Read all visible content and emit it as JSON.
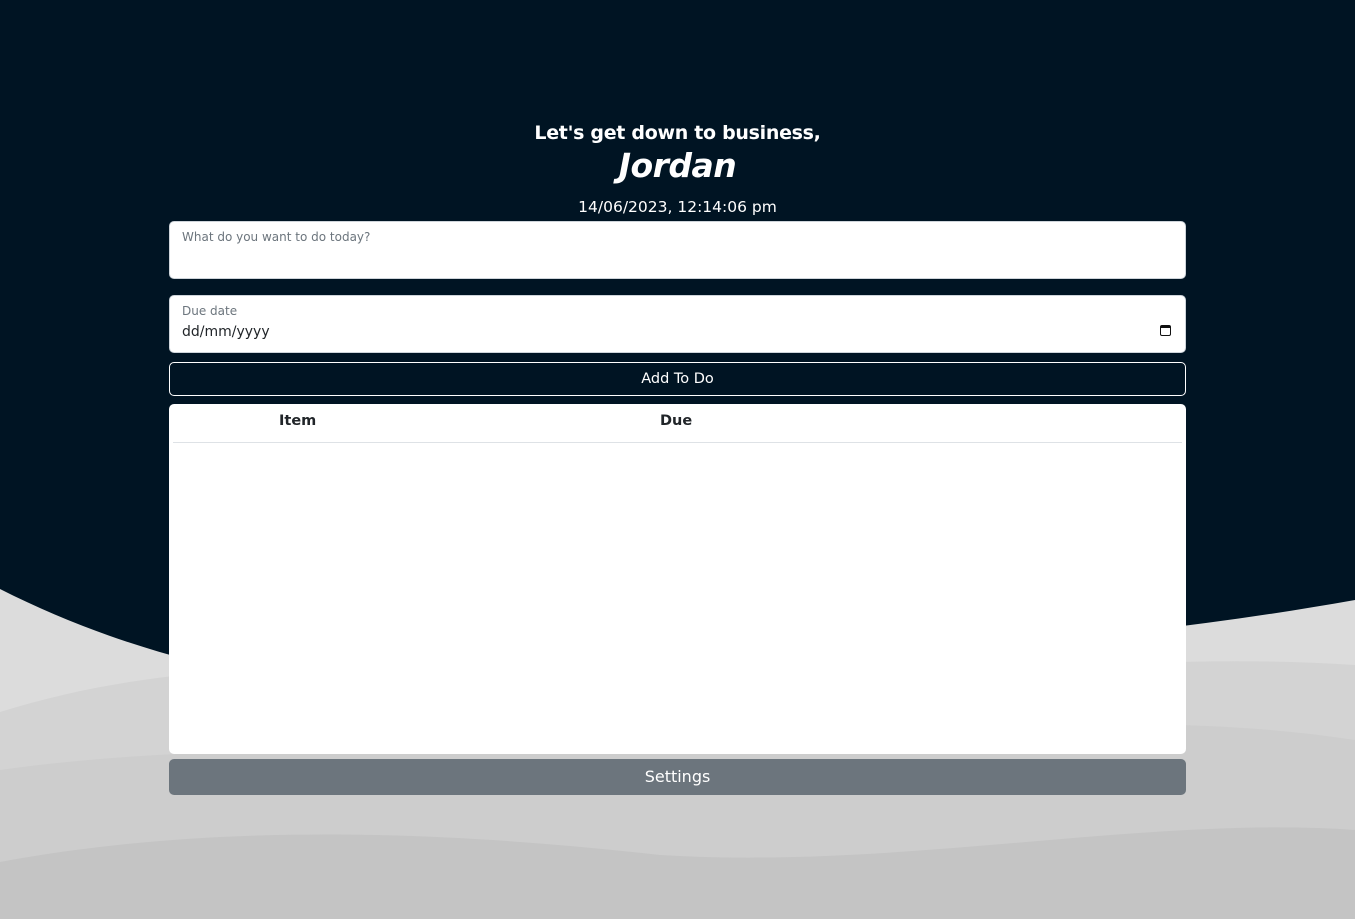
{
  "header": {
    "greeting": "Let's get down to business,",
    "username": "Jordan",
    "datetime": "14/06/2023, 12:14:06 pm"
  },
  "form": {
    "task_label": "What do you want to do today?",
    "task_value": "",
    "due_label": "Due date",
    "due_value": "dd/mm/yyyy",
    "calendar_icon": "calendar-icon",
    "add_button_label": "Add To Do"
  },
  "table": {
    "columns": [
      "Item",
      "Due"
    ],
    "rows": []
  },
  "footer": {
    "settings_label": "Settings"
  },
  "colors": {
    "background_top": "#001423",
    "settings_button": "#6c757d",
    "card": "#ffffff"
  }
}
